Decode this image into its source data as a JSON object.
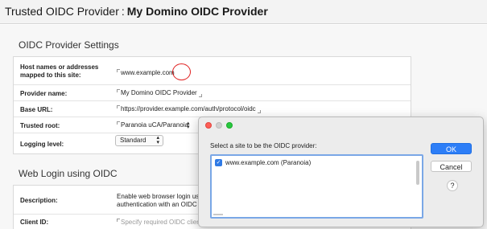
{
  "header": {
    "prefix": "Trusted OIDC Provider",
    "separator": ":",
    "name": "My Domino OIDC Provider"
  },
  "settings": {
    "heading": "OIDC Provider Settings",
    "rows": [
      {
        "label_line1": "Host names or addresses",
        "label_line2": "mapped to this site:",
        "value": "www.example.com"
      },
      {
        "label": "Provider name:",
        "value": "My Domino OIDC Provider"
      },
      {
        "label": "Base URL:",
        "value": "https://provider.example.com/auth/protocol/oidc"
      },
      {
        "label": "Trusted root:",
        "value": "Paranoia uCA/Paranoia"
      },
      {
        "label": "Logging level:",
        "value": "Standard"
      }
    ]
  },
  "web_login": {
    "heading": "Web Login using OIDC",
    "description_label": "Description:",
    "description_line1": "Enable web browser login using",
    "description_line2": "authentication with an OIDC pr",
    "client_id_label": "Client ID:",
    "client_id_placeholder": "Specify required OIDC client I"
  },
  "dialog": {
    "prompt": "Select a site to be the OIDC provider:",
    "sites": [
      {
        "label": "www.example.com (Paranoia)",
        "checked": true
      }
    ],
    "ok_label": "OK",
    "cancel_label": "Cancel",
    "help_label": "?"
  },
  "icons": {
    "checkmark": "checkmark-icon",
    "select_arrows": "chevron-updown-icon"
  },
  "colors": {
    "accent": "#2d7ef7",
    "highlight_circle": "#e02020"
  }
}
